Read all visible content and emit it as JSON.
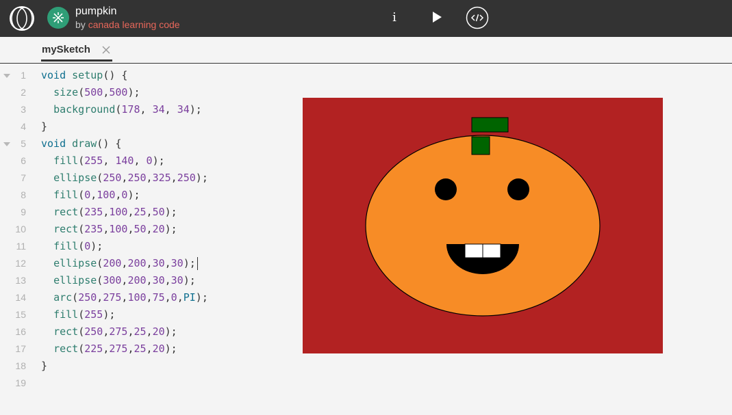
{
  "header": {
    "project_name": "pumpkin",
    "by_prefix": "by ",
    "author": "canada learning code",
    "info_label": "i",
    "icons": [
      "app-logo-icon",
      "project-icon",
      "info-icon",
      "play-icon",
      "code-icon"
    ]
  },
  "tab": {
    "label": "mySketch",
    "close_icon": "close-icon"
  },
  "editor": {
    "lines": [
      {
        "n": "1",
        "text": "void setup() {",
        "fold": true
      },
      {
        "n": "2",
        "text": "  size(500,500);",
        "fold": false
      },
      {
        "n": "3",
        "text": "  background(178, 34, 34);",
        "fold": false
      },
      {
        "n": "4",
        "text": "}",
        "fold": false
      },
      {
        "n": "5",
        "text": "void draw() {",
        "fold": true
      },
      {
        "n": "6",
        "text": "  fill(255, 140, 0);",
        "fold": false
      },
      {
        "n": "7",
        "text": "  ellipse(250,250,325,250);",
        "fold": false
      },
      {
        "n": "8",
        "text": "  fill(0,100,0);",
        "fold": false
      },
      {
        "n": "9",
        "text": "  rect(235,100,25,50);",
        "fold": false
      },
      {
        "n": "10",
        "text": "  rect(235,100,50,20);",
        "fold": false
      },
      {
        "n": "11",
        "text": "  fill(0);",
        "fold": false
      },
      {
        "n": "12",
        "text": "  ellipse(200,200,30,30);",
        "fold": false,
        "cursor": true
      },
      {
        "n": "13",
        "text": "  ellipse(300,200,30,30);",
        "fold": false
      },
      {
        "n": "14",
        "text": "  arc(250,275,100,75,0,PI);",
        "fold": false
      },
      {
        "n": "15",
        "text": "  fill(255);",
        "fold": false
      },
      {
        "n": "16",
        "text": "  rect(250,275,25,20);",
        "fold": false
      },
      {
        "n": "17",
        "text": "  rect(225,275,25,20);",
        "fold": false
      },
      {
        "n": "18",
        "text": "}",
        "fold": false
      },
      {
        "n": "19",
        "text": "",
        "fold": false
      }
    ]
  },
  "sketch": {
    "background": "#b22222",
    "pumpkin_color": "#f78c26",
    "stem_color": "#006400",
    "features_color": "#000000",
    "teeth_color": "#ffffff"
  },
  "colors": {
    "topbar": "#333333",
    "author": "#e8675a",
    "project_icon": "#2f9e77"
  }
}
